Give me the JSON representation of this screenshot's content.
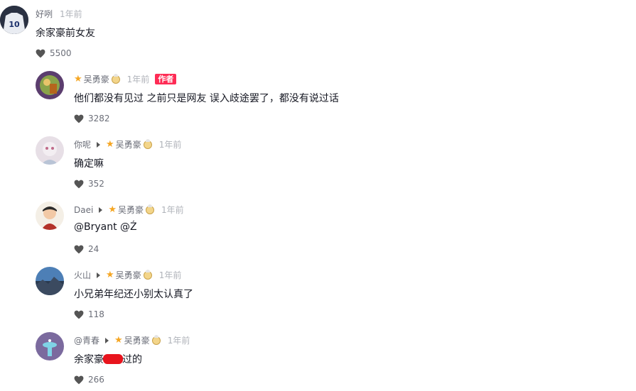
{
  "comments": [
    {
      "name": "好咧",
      "time": "1年前",
      "text": "余家豪前女友",
      "likes": "5500",
      "avatar_text": "10"
    },
    {
      "name": "吴勇豪",
      "time": "1年前",
      "badge": "作者",
      "text": "他们都没有见过 之前只是网友 误入歧途罢了，都没有说过话",
      "likes": "3282"
    },
    {
      "name": "你呢",
      "reply_to": "吴勇豪",
      "time": "1年前",
      "text": "确定嘛",
      "likes": "352"
    },
    {
      "name": "Daei",
      "reply_to": "吴勇豪",
      "time": "1年前",
      "text": "@Bryant  @Ź",
      "likes": "24"
    },
    {
      "name": "火山",
      "reply_to": "吴勇豪",
      "time": "1年前",
      "text": "小兄弟年纪还小别太认真了",
      "likes": "118"
    },
    {
      "name": "@青春",
      "reply_to": "吴勇豪",
      "time": "1年前",
      "text_before": "余家豪",
      "text_after": "过的",
      "likes": "266"
    }
  ],
  "colors": {
    "accent": "#fe2c55",
    "star": "#f5a623",
    "muted": "#6b6e78"
  },
  "icons": [
    "heart-icon",
    "star-icon",
    "face-icon",
    "reply-arrow-icon"
  ]
}
